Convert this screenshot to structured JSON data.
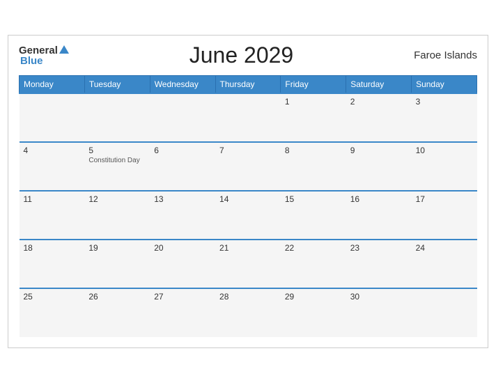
{
  "header": {
    "logo_general": "General",
    "logo_blue": "Blue",
    "title": "June 2029",
    "region": "Faroe Islands"
  },
  "days_of_week": [
    "Monday",
    "Tuesday",
    "Wednesday",
    "Thursday",
    "Friday",
    "Saturday",
    "Sunday"
  ],
  "weeks": [
    [
      {
        "day": "",
        "empty": true
      },
      {
        "day": "",
        "empty": true
      },
      {
        "day": "",
        "empty": true
      },
      {
        "day": "",
        "empty": true
      },
      {
        "day": "1",
        "empty": false
      },
      {
        "day": "2",
        "empty": false
      },
      {
        "day": "3",
        "empty": false
      }
    ],
    [
      {
        "day": "4",
        "empty": false
      },
      {
        "day": "5",
        "empty": false,
        "event": "Constitution Day"
      },
      {
        "day": "6",
        "empty": false
      },
      {
        "day": "7",
        "empty": false
      },
      {
        "day": "8",
        "empty": false
      },
      {
        "day": "9",
        "empty": false
      },
      {
        "day": "10",
        "empty": false
      }
    ],
    [
      {
        "day": "11",
        "empty": false
      },
      {
        "day": "12",
        "empty": false
      },
      {
        "day": "13",
        "empty": false
      },
      {
        "day": "14",
        "empty": false
      },
      {
        "day": "15",
        "empty": false
      },
      {
        "day": "16",
        "empty": false
      },
      {
        "day": "17",
        "empty": false
      }
    ],
    [
      {
        "day": "18",
        "empty": false
      },
      {
        "day": "19",
        "empty": false
      },
      {
        "day": "20",
        "empty": false
      },
      {
        "day": "21",
        "empty": false
      },
      {
        "day": "22",
        "empty": false
      },
      {
        "day": "23",
        "empty": false
      },
      {
        "day": "24",
        "empty": false
      }
    ],
    [
      {
        "day": "25",
        "empty": false
      },
      {
        "day": "26",
        "empty": false
      },
      {
        "day": "27",
        "empty": false
      },
      {
        "day": "28",
        "empty": false
      },
      {
        "day": "29",
        "empty": false
      },
      {
        "day": "30",
        "empty": false
      },
      {
        "day": "",
        "empty": true
      }
    ]
  ]
}
